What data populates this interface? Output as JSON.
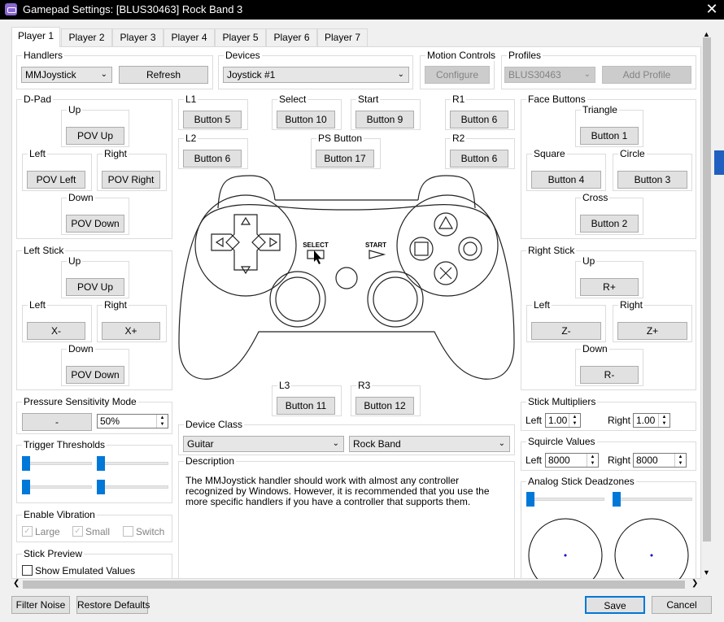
{
  "window": {
    "title": "Gamepad Settings: [BLUS30463] Rock Band 3"
  },
  "tabs": [
    "Player 1",
    "Player 2",
    "Player 3",
    "Player 4",
    "Player 5",
    "Player 6",
    "Player 7"
  ],
  "handlers": {
    "label": "Handlers",
    "value": "MMJoystick",
    "refresh": "Refresh"
  },
  "devices": {
    "label": "Devices",
    "value": "Joystick #1"
  },
  "motion": {
    "label": "Motion Controls",
    "configure": "Configure"
  },
  "profiles": {
    "label": "Profiles",
    "value": "BLUS30463",
    "add": "Add Profile"
  },
  "dpad": {
    "label": "D-Pad",
    "up": "Up",
    "up_btn": "POV Up",
    "left": "Left",
    "left_btn": "POV Left",
    "right": "Right",
    "right_btn": "POV Right",
    "down": "Down",
    "down_btn": "POV Down"
  },
  "leftstick": {
    "label": "Left Stick",
    "up": "Up",
    "up_btn": "POV Up",
    "left": "Left",
    "left_btn": "X-",
    "right": "Right",
    "right_btn": "X+",
    "down": "Down",
    "down_btn": "POV Down"
  },
  "pressure": {
    "label": "Pressure Sensitivity Mode",
    "btn": "-",
    "value": "50%"
  },
  "trigger": {
    "label": "Trigger Thresholds"
  },
  "vibration": {
    "label": "Enable Vibration",
    "large": "Large",
    "small": "Small",
    "switch": "Switch"
  },
  "preview": {
    "label": "Stick Preview",
    "show": "Show Emulated Values"
  },
  "center": {
    "l1": "L1",
    "l1_btn": "Button 5",
    "select": "Select",
    "select_btn": "Button 10",
    "start": "Start",
    "start_btn": "Button 9",
    "r1": "R1",
    "r1_btn": "Button 6",
    "l2": "L2",
    "l2_btn": "Button 6",
    "ps": "PS Button",
    "ps_btn": "Button 17",
    "r2": "R2",
    "r2_btn": "Button 6",
    "l3": "L3",
    "l3_btn": "Button 11",
    "r3": "R3",
    "r3_btn": "Button 12",
    "pad_select": "SELECT",
    "pad_start": "START"
  },
  "device_class": {
    "label": "Device Class",
    "value": "Guitar",
    "subvalue": "Rock Band"
  },
  "description": {
    "label": "Description",
    "text": "The MMJoystick handler should work with almost any controller recognized by Windows. However, it is recommended that you use the more specific handlers if you have a controller that supports them."
  },
  "face": {
    "label": "Face Buttons",
    "triangle": "Triangle",
    "triangle_btn": "Button 1",
    "square": "Square",
    "square_btn": "Button 4",
    "circle": "Circle",
    "circle_btn": "Button 3",
    "cross": "Cross",
    "cross_btn": "Button 2"
  },
  "rightstick": {
    "label": "Right Stick",
    "up": "Up",
    "up_btn": "R+",
    "left": "Left",
    "left_btn": "Z-",
    "right": "Right",
    "right_btn": "Z+",
    "down": "Down",
    "down_btn": "R-"
  },
  "multipliers": {
    "label": "Stick Multipliers",
    "left": "Left",
    "left_val": "1.00",
    "right": "Right",
    "right_val": "1.00"
  },
  "squircle": {
    "label": "Squircle Values",
    "left": "Left",
    "left_val": "8000",
    "right": "Right",
    "right_val": "8000"
  },
  "deadzones": {
    "label": "Analog Stick Deadzones"
  },
  "footer": {
    "filter": "Filter Noise",
    "restore": "Restore Defaults",
    "save": "Save",
    "cancel": "Cancel"
  },
  "colors": {
    "accent": "#0078d7",
    "titlebar": "#000000"
  }
}
